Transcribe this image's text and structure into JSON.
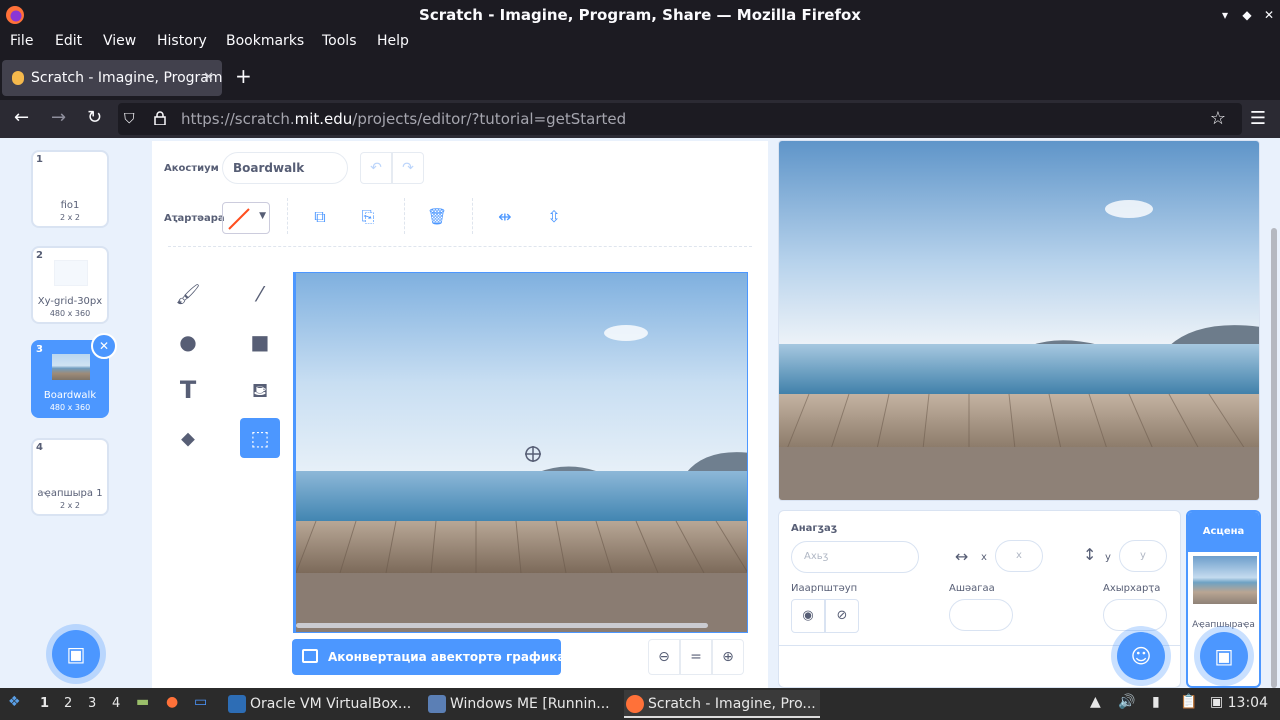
{
  "window": {
    "title": "Scratch - Imagine, Program, Share — Mozilla Firefox"
  },
  "menu": [
    "File",
    "Edit",
    "View",
    "History",
    "Bookmarks",
    "Tools",
    "Help"
  ],
  "tab": {
    "title": "Scratch - Imagine, Program, Share"
  },
  "url": {
    "prefix": "https://scratch.",
    "domain": "mit.edu",
    "path": "/projects/editor/?tutorial=getStarted"
  },
  "costumes": [
    {
      "num": "1",
      "name": "fio1",
      "size": "2 x 2"
    },
    {
      "num": "2",
      "name": "Xy-grid-30px",
      "size": "480 x 360"
    },
    {
      "num": "3",
      "name": "Boardwalk",
      "size": "480 x 360"
    },
    {
      "num": "4",
      "name": "аҿапшыра 1",
      "size": "2 x 2"
    }
  ],
  "editor": {
    "costume_label": "Акостиум",
    "costume_name": "Boardwalk",
    "outline_label": "Аҭартәара",
    "convert_label": "Аконвертациа авектортә графика ахь",
    "zoom_reset": "="
  },
  "sprite_info": {
    "name_label": "Анагӡаӡ",
    "name_placeholder": "Ахьӡ",
    "x_label": "x",
    "x_placeholder": "x",
    "y_label": "y",
    "y_placeholder": "y",
    "show_label": "Иаарпштәуп",
    "size_label": "Ашәагаа",
    "direction_label": "Ахырхарҭа"
  },
  "stage_panel": {
    "header": "Асцена",
    "backdrops_label": "Аҿапшыраҿа"
  },
  "taskbar": {
    "workspaces": [
      "1",
      "2",
      "3",
      "4"
    ],
    "tasks": [
      "Oracle VM VirtualBox...",
      "Windows ME [Runnin...",
      "Scratch - Imagine, Pro..."
    ],
    "clock": "13:04"
  },
  "colors": {
    "accent": "#4c97ff",
    "firefox_dark": "#1c1b22"
  }
}
